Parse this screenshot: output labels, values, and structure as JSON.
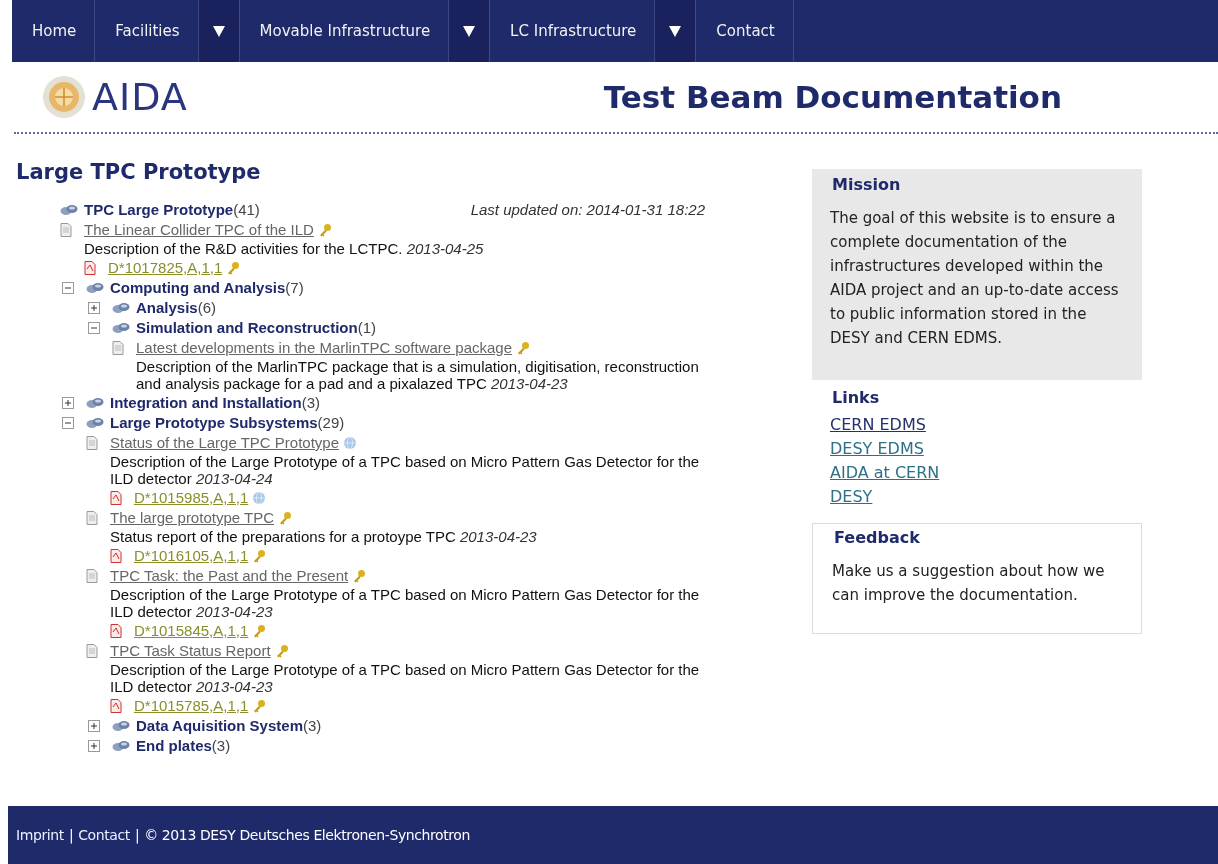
{
  "nav": [
    {
      "label": "Home",
      "dropdown": false
    },
    {
      "label": "Facilities",
      "dropdown": true
    },
    {
      "label": "Movable Infrastructure",
      "dropdown": true
    },
    {
      "label": "LC Infrastructure",
      "dropdown": true
    },
    {
      "label": "Contact",
      "dropdown": false
    }
  ],
  "header": {
    "logo_text": "AIDA",
    "title": "Test Beam Documentation"
  },
  "main": {
    "heading": "Large TPC Prototype",
    "last_updated": "Last updated on: 2014-01-31 18:22",
    "tree": {
      "kind": "folder",
      "label": "TPC Large Prototype",
      "count": "(41)",
      "children": [
        {
          "kind": "document",
          "title": "The Linear Collider TPC of the ILD",
          "badge": {
            "kind": "key"
          },
          "description": "Description of the R&D activities for the LCTPC.",
          "date": "2013-04-25",
          "file": {
            "name": "D*1017825,A,1,1",
            "badge": {
              "kind": "key"
            }
          }
        },
        {
          "kind": "folder",
          "label": "Computing and Analysis",
          "count": "(7)",
          "expanded": true,
          "children": [
            {
              "kind": "folder",
              "label": "Analysis",
              "count": "(6)",
              "expanded": false
            },
            {
              "kind": "folder",
              "label": "Simulation and Reconstruction",
              "count": "(1)",
              "expanded": true,
              "children": [
                {
                  "kind": "document",
                  "title": "Latest developments in the MarlinTPC software package",
                  "badge": {
                    "kind": "key"
                  },
                  "description": "Description of the MarlinTPC package that is a simulation, digitisation, reconstruction and analysis package for a pad and a pixalazed TPC",
                  "date": "2013-04-23"
                }
              ]
            }
          ]
        },
        {
          "kind": "folder",
          "label": "Integration and Installation",
          "count": "(3)",
          "expanded": false
        },
        {
          "kind": "folder",
          "label": "Large Prototype Subsystems",
          "count": "(29)",
          "expanded": true,
          "children": [
            {
              "kind": "document",
              "title": "Status of the Large TPC Prototype",
              "badge": {
                "kind": "globe"
              },
              "description": "Description of the Large Prototype of a TPC based on Micro Pattern Gas Detector for the ILD detector",
              "date": "2013-04-24",
              "file": {
                "name": "D*1015985,A,1,1",
                "badge": {
                  "kind": "globe"
                }
              }
            },
            {
              "kind": "document",
              "title": "The large prototype TPC",
              "badge": {
                "kind": "key"
              },
              "description": "Status report of the preparations for a protoype TPC",
              "date": "2013-04-23",
              "file": {
                "name": "D*1016105,A,1,1",
                "badge": {
                  "kind": "key"
                }
              }
            },
            {
              "kind": "document",
              "title": "TPC Task: the Past and the Present",
              "badge": {
                "kind": "key"
              },
              "description": "Description of the Large Prototype of a TPC based on Micro Pattern Gas Detector for the ILD detector",
              "date": "2013-04-23",
              "file": {
                "name": "D*1015845,A,1,1",
                "badge": {
                  "kind": "key"
                }
              }
            },
            {
              "kind": "document",
              "title": "TPC Task Status Report",
              "badge": {
                "kind": "key"
              },
              "description": "Description of the Large Prototype of a TPC based on Micro Pattern Gas Detector for the ILD detector",
              "date": "2013-04-23",
              "file": {
                "name": "D*1015785,A,1,1",
                "badge": {
                  "kind": "key"
                }
              }
            },
            {
              "kind": "folder",
              "label": "Data Aquisition System",
              "count": "(3)",
              "expanded": false
            },
            {
              "kind": "folder",
              "label": "End plates",
              "count": "(3)",
              "expanded": false
            }
          ]
        }
      ]
    }
  },
  "sidebar": {
    "mission": {
      "heading": "Mission",
      "text": "The goal of this website is to ensure a complete documentation of the infrastructures developed within the AIDA project and an up-to-date access to public information stored in the DESY and CERN EDMS."
    },
    "links": {
      "heading": "Links",
      "items": [
        {
          "label": "CERN EDMS",
          "visited": true
        },
        {
          "label": "DESY EDMS",
          "visited": false
        },
        {
          "label": "AIDA at CERN",
          "visited": false
        },
        {
          "label": "DESY",
          "visited": false
        }
      ]
    },
    "feedback": {
      "heading": "Feedback",
      "text": "Make us a suggestion about how we can improve the documentation."
    }
  },
  "footer": [
    {
      "kind": "link",
      "text": "Imprint"
    },
    {
      "kind": "separator",
      "text": "|"
    },
    {
      "kind": "link",
      "text": "Contact"
    },
    {
      "kind": "separator",
      "text": "|"
    },
    {
      "kind": "text",
      "text": "© 2013 DESY Deutsches Elektronen-Synchrotron"
    }
  ]
}
